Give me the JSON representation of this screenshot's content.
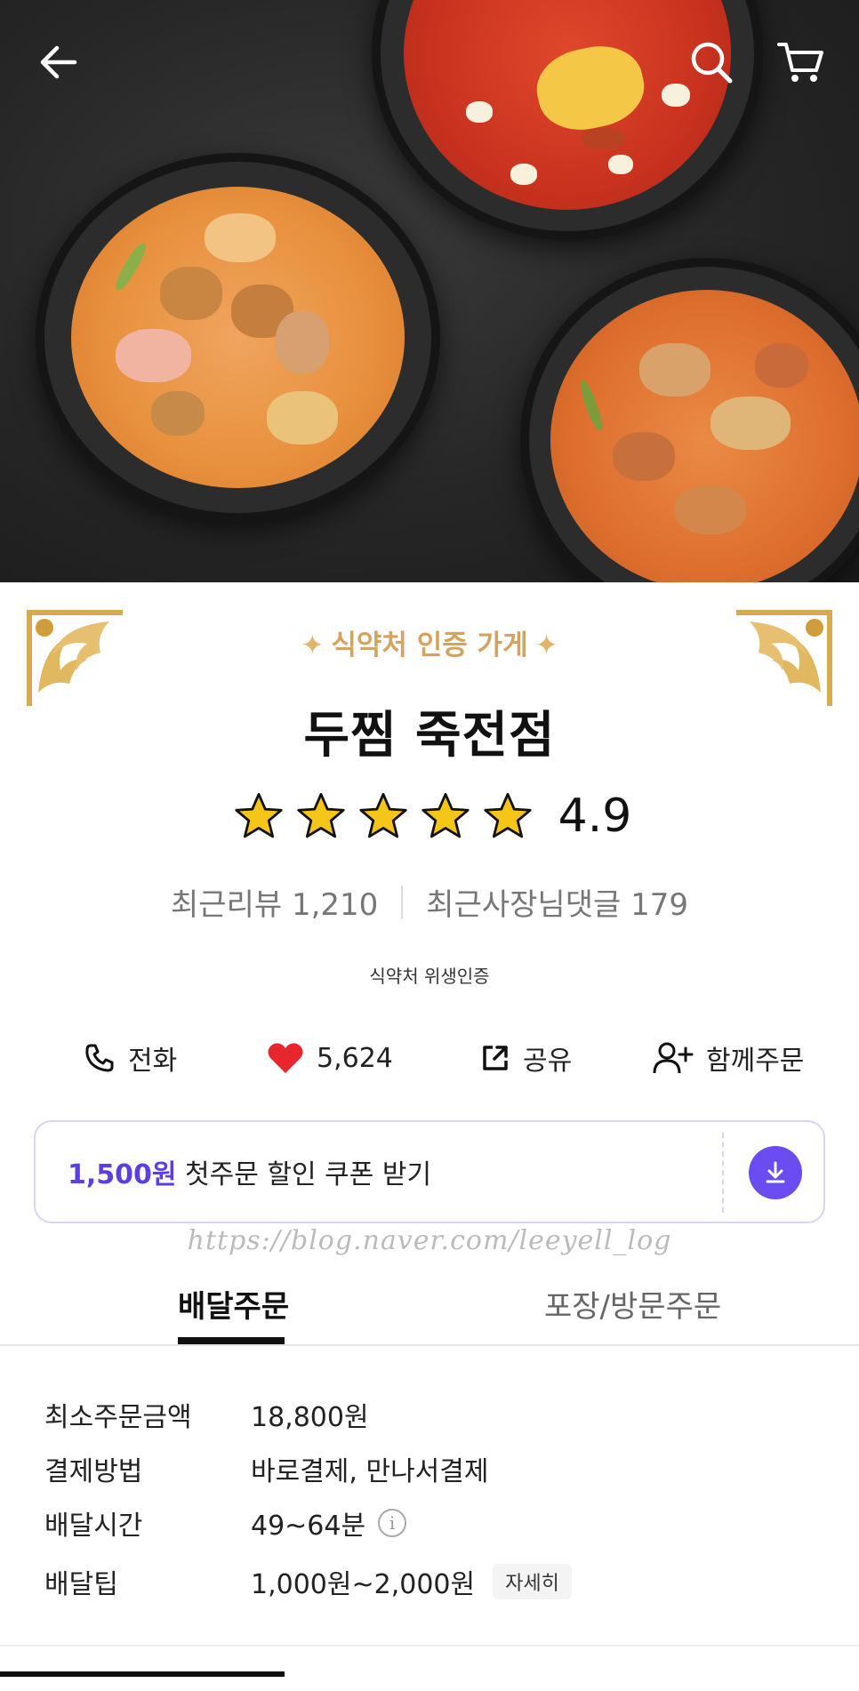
{
  "header": {
    "back_icon": "arrow-left-icon",
    "search_icon": "search-icon",
    "cart_icon": "cart-icon"
  },
  "store": {
    "cert_badge": "식약처 인증 가게",
    "name": "두찜 죽전점",
    "rating": "4.9",
    "rating_stars": 5,
    "recent_reviews": "최근리뷰 1,210",
    "owner_comments": "최근사장님댓글 179",
    "hygiene": "식약처 위생인증"
  },
  "actions": {
    "call": "전화",
    "likes": "5,624",
    "share": "공유",
    "group_order": "함께주문"
  },
  "coupon": {
    "amount": "1,500원",
    "text": " 첫주문 할인 쿠폰 받기"
  },
  "watermark": "https://blog.naver.com/leeyell_log",
  "tabs": {
    "delivery": "배달주문",
    "takeout": "포장/방문주문"
  },
  "info": {
    "min_order_label": "최소주문금액",
    "min_order_value": "18,800원",
    "payment_label": "결제방법",
    "payment_value": "바로결제, 만나서결제",
    "time_label": "배달시간",
    "time_value": "49~64분",
    "info_icon": "i",
    "tip_label": "배달팁",
    "tip_value": "1,000원~2,000원",
    "detail": "자세히"
  },
  "colors": {
    "accent": "#6a4cf0",
    "coupon_amount": "#5b3fe0",
    "gold": "#d3a45f",
    "heart": "#e8262e",
    "star": "#f5c518"
  }
}
